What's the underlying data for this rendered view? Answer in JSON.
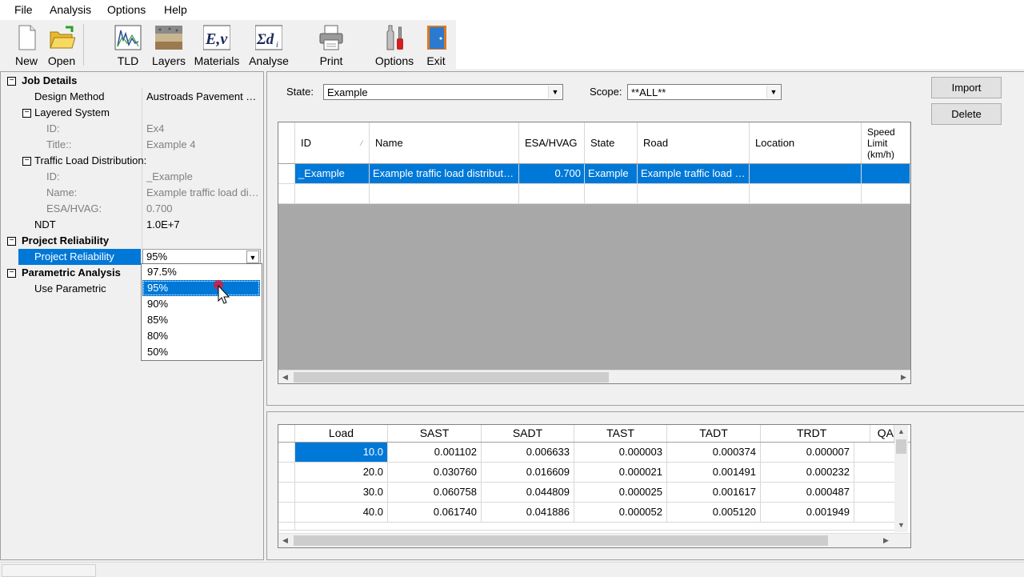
{
  "menu": [
    "File",
    "Analysis",
    "Options",
    "Help"
  ],
  "toolbar": [
    {
      "label": "New",
      "icon": "new-document-icon"
    },
    {
      "label": "Open",
      "icon": "open-folder-icon"
    },
    {
      "label": "TLD",
      "icon": "tld-chart-icon"
    },
    {
      "label": "Layers",
      "icon": "layers-icon"
    },
    {
      "label": "Materials",
      "icon": "materials-ev-icon"
    },
    {
      "label": "Analyse",
      "icon": "sigma-di-icon"
    },
    {
      "label": "Print",
      "icon": "printer-icon"
    },
    {
      "label": "Options",
      "icon": "tools-icon"
    },
    {
      "label": "Exit",
      "icon": "exit-door-icon"
    }
  ],
  "properties": {
    "job_details": {
      "label": "Job Details"
    },
    "design_method": {
      "label": "Design Method",
      "value": "Austroads Pavement De..."
    },
    "layered_system": {
      "label": "Layered System"
    },
    "ls_id": {
      "label": "ID:",
      "value": "Ex4"
    },
    "ls_title": {
      "label": "Title::",
      "value": "Example 4"
    },
    "tld": {
      "label": "Traffic Load Distribution:"
    },
    "tld_id": {
      "label": "ID:",
      "value": "_Example"
    },
    "tld_name": {
      "label": "Name:",
      "value": "Example traffic load distr..."
    },
    "tld_esa": {
      "label": "ESA/HVAG:",
      "value": "0.700"
    },
    "ndt": {
      "label": "NDT",
      "value": "1.0E+7"
    },
    "project_reliability_cat": {
      "label": "Project Reliability"
    },
    "project_reliability": {
      "label": "Project Reliability",
      "value": "95%"
    },
    "parametric_analysis": {
      "label": "Parametric Analysis"
    },
    "use_parametric": {
      "label": "Use Parametric"
    }
  },
  "reliability_options": [
    "97.5%",
    "95%",
    "90%",
    "85%",
    "80%",
    "50%"
  ],
  "reliability_selected": "95%",
  "filters": {
    "state_label": "State:",
    "state_value": "Example",
    "scope_label": "Scope:",
    "scope_value": "**ALL**"
  },
  "buttons": {
    "import": "Import",
    "delete": "Delete"
  },
  "tld_table": {
    "columns": [
      "ID",
      "Name",
      "ESA/HVAG",
      "State",
      "Road",
      "Location",
      "Speed Limit (km/h)"
    ],
    "rows": [
      [
        "_Example",
        "Example traffic load distributio...",
        "0.700",
        "Example",
        "Example traffic load di...",
        "",
        ""
      ]
    ]
  },
  "load_table": {
    "columns": [
      "Load",
      "SAST",
      "SADT",
      "TAST",
      "TADT",
      "TRDT",
      "QA"
    ],
    "rows": [
      [
        "10.0",
        "0.001102",
        "0.006633",
        "0.000003",
        "0.000374",
        "0.000007",
        ""
      ],
      [
        "20.0",
        "0.030760",
        "0.016609",
        "0.000021",
        "0.001491",
        "0.000232",
        ""
      ],
      [
        "30.0",
        "0.060758",
        "0.044809",
        "0.000025",
        "0.001617",
        "0.000487",
        ""
      ],
      [
        "40.0",
        "0.061740",
        "0.041886",
        "0.000052",
        "0.005120",
        "0.001949",
        ""
      ]
    ]
  },
  "colors": {
    "selection": "#0078d7",
    "grid_empty": "#a8a8a8"
  }
}
